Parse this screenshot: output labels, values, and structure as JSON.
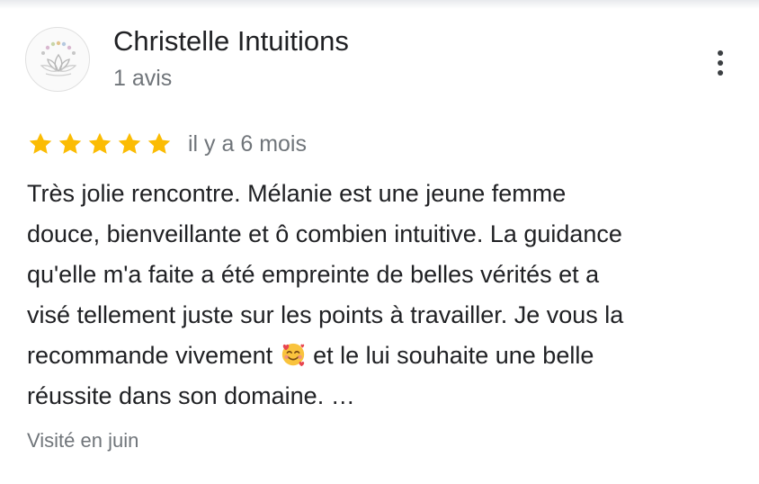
{
  "review": {
    "author": {
      "name": "Christelle Intuitions",
      "review_count": "1 avis",
      "avatar_icon": "lotus-logo-icon"
    },
    "more_options_icon": "more-vert-icon",
    "rating": {
      "stars": 5,
      "max": 5,
      "star_color": "#fbbc04"
    },
    "date": "il y a 6 mois",
    "text_lines": [
      "Très jolie rencontre. Mélanie est une jeune femme",
      "douce, bienveillante et ô combien intuitive. La guidance",
      "qu'elle m'a faite a été empreinte de belles vérités et a",
      "visé tellement juste sur les points à travailler. Je vous la",
      "recommande vivement ",
      " et le lui souhaite une belle",
      "réussite dans son domaine. …"
    ],
    "emoji_icon": "smiling-face-with-hearts-icon",
    "visit": "Visité en juin"
  }
}
